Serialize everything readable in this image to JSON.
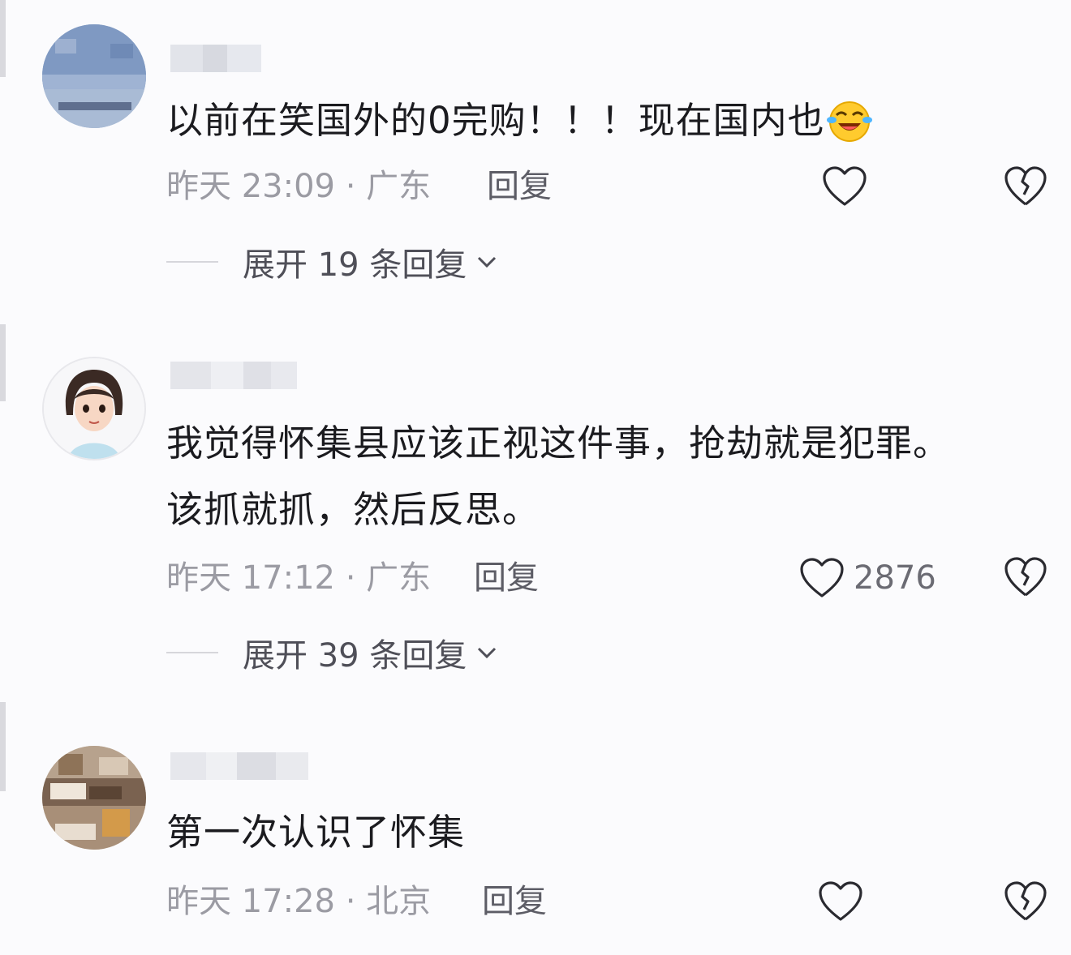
{
  "comments": [
    {
      "text": "以前在笑国外的0完购！！！现在国内也",
      "emoji": "laughing-crying-emoji",
      "meta": "昨天 23:09 · 广东",
      "reply_label": "回复",
      "like_count": "",
      "expand_label": "展开 19 条回复"
    },
    {
      "text": "我觉得怀集县应该正视这件事，抢劫就是犯罪。该抓就抓，然后反思。",
      "meta": "昨天 17:12 · 广东",
      "reply_label": "回复",
      "like_count": "2876",
      "expand_label": "展开 39 条回复"
    },
    {
      "text": "第一次认识了怀集",
      "meta": "昨天 17:28 · 北京",
      "reply_label": "回复",
      "like_count": ""
    }
  ],
  "icons": {
    "like": "heart-outline-icon",
    "dislike": "broken-heart-icon",
    "expand": "chevron-down-icon"
  },
  "colors": {
    "background": "#fbfbfd",
    "text": "#1b1b1f",
    "meta": "#9b9ba3"
  }
}
